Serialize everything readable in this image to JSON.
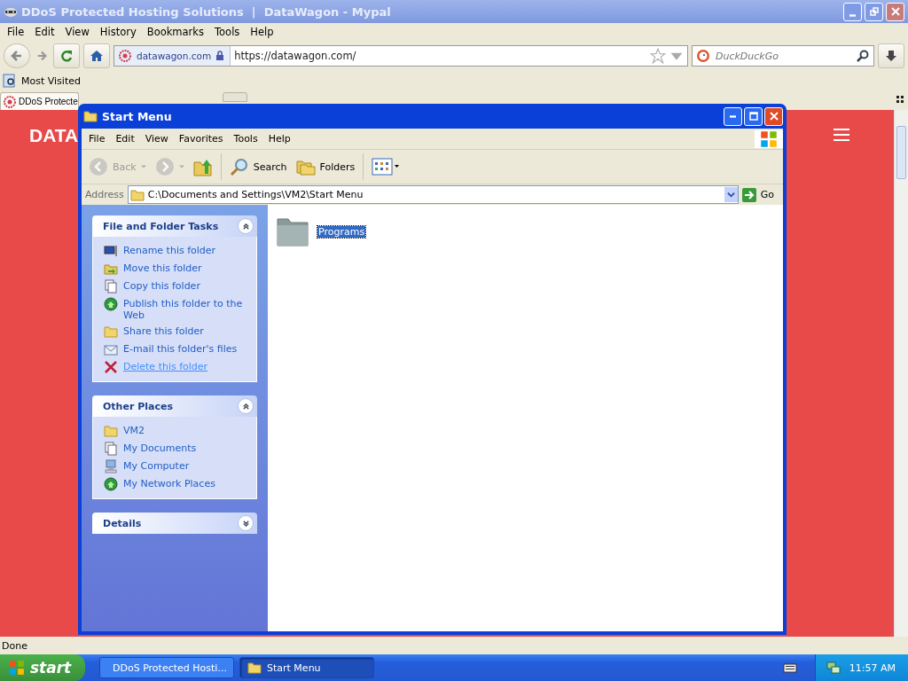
{
  "browser": {
    "title": "DDoS Protected Hosting Solutions  |  DataWagon - Mypal",
    "menu": [
      "File",
      "Edit",
      "View",
      "History",
      "Bookmarks",
      "Tools",
      "Help"
    ],
    "site_label": "datawagon.com",
    "url": "https://datawagon.com/",
    "search_placeholder": "DuckDuckGo",
    "bookmarks": [
      {
        "label": "Most Visited"
      }
    ],
    "tab": {
      "label": "DDoS Protecte"
    },
    "page": {
      "brand": "DATA"
    },
    "status": "Done"
  },
  "explorer": {
    "title": "Start Menu",
    "menu": [
      "File",
      "Edit",
      "View",
      "Favorites",
      "Tools",
      "Help"
    ],
    "toolbar": [
      {
        "kind": "back",
        "label": "Back",
        "disabled": true
      },
      {
        "kind": "forward",
        "disabled": true
      },
      {
        "kind": "up",
        "disabled": false
      },
      {
        "kind": "search",
        "label": "Search",
        "disabled": false
      },
      {
        "kind": "folders",
        "label": "Folders",
        "disabled": false
      },
      {
        "kind": "views",
        "disabled": false
      }
    ],
    "address_label": "Address",
    "address": "C:\\Documents and Settings\\VM2\\Start Menu",
    "go_label": "Go",
    "panels": [
      {
        "title": "File and Folder Tasks",
        "expanded": true,
        "items": [
          {
            "label": "Rename this folder",
            "hover": false
          },
          {
            "label": "Move this folder",
            "hover": false
          },
          {
            "label": "Copy this folder",
            "hover": false
          },
          {
            "label": "Publish this folder to the Web",
            "hover": false
          },
          {
            "label": "Share this folder",
            "hover": false
          },
          {
            "label": "E-mail this folder's files",
            "hover": false
          },
          {
            "label": "Delete this folder",
            "hover": true
          }
        ]
      },
      {
        "title": "Other Places",
        "expanded": true,
        "items": [
          {
            "label": "VM2",
            "hover": false
          },
          {
            "label": "My Documents",
            "hover": false
          },
          {
            "label": "My Computer",
            "hover": false
          },
          {
            "label": "My Network Places",
            "hover": false
          }
        ]
      },
      {
        "title": "Details",
        "expanded": false
      }
    ],
    "files": [
      {
        "name": "Programs",
        "selected": true
      }
    ]
  },
  "taskbar": {
    "start": "start",
    "tasks": [
      {
        "label": "DDoS Protected Hosti...",
        "selected": false
      },
      {
        "label": "Start Menu",
        "selected": true
      }
    ],
    "clock": "11:57 AM"
  }
}
